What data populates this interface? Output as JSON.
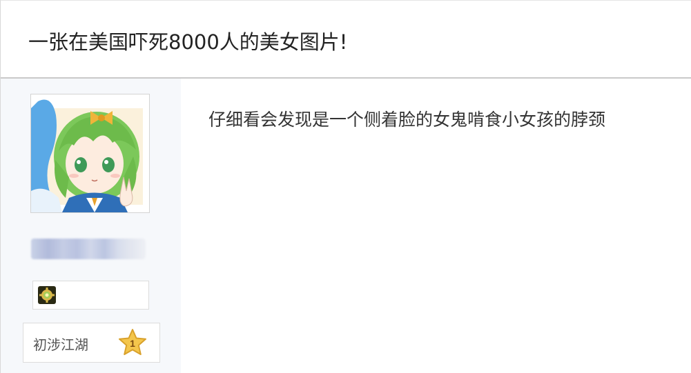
{
  "thread": {
    "title": "一张在美国吓死8000人的美女图片!"
  },
  "author": {
    "avatar_icon": "anime-girl-avatar-icon",
    "medal_icon": "gold-gear-medal-icon",
    "rank": {
      "label": "初涉江湖",
      "level": "1",
      "icon": "star-icon"
    }
  },
  "post": {
    "content": "仔细看会发现是一个侧着脸的女鬼啃食小女孩的脖颈"
  },
  "colors": {
    "sidebar_bg": "#f6f8fb",
    "star_fill": "#f4c64c",
    "star_outline": "#d9a12b",
    "text_main": "#333333"
  }
}
